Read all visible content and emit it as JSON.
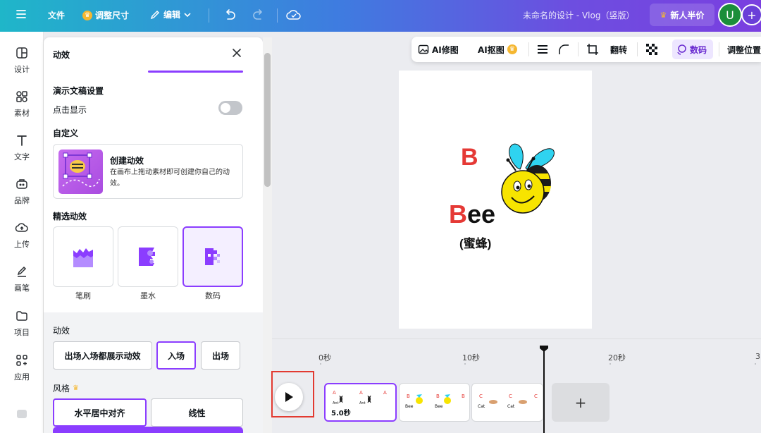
{
  "topbar": {
    "file": "文件",
    "resize": "调整尺寸",
    "edit": "编辑",
    "doc_title": "未命名的设计 - Vlog（竖版）",
    "new_user": "新人半价",
    "avatar_letter": "U",
    "plus": "+"
  },
  "rail": [
    "设计",
    "素材",
    "文字",
    "品牌",
    "上传",
    "画笔",
    "项目",
    "应用"
  ],
  "panel": {
    "title": "动效",
    "presentation_header": "演示文稿设置",
    "click_show": "点击显示",
    "custom_header": "自定义",
    "create_title": "创建动效",
    "create_desc": "在画布上拖动素材即可创建你自己的动效。",
    "featured_header": "精选动效",
    "effects": [
      "笔刷",
      "墨水",
      "数码"
    ],
    "anim_header": "动效",
    "anim_buttons": [
      "出场入场都展示动效",
      "入场",
      "出场"
    ],
    "style_header": "风格",
    "style_buttons": [
      "水平居中对齐",
      "线性"
    ]
  },
  "context_toolbar": {
    "ai_edit": "AI修图",
    "ai_cutout": "AI抠图",
    "flip": "翻转",
    "digital": "数码",
    "adjust": "调整位置"
  },
  "canvas": {
    "letter": "B",
    "word_first": "B",
    "word_rest": "ee",
    "translation": "(蜜蜂)",
    "letter_color": "#e53935"
  },
  "timeline": {
    "ticks": [
      "0秒",
      "10秒",
      "20秒",
      "3"
    ],
    "clip_duration": "5.0秒",
    "add": "+"
  }
}
